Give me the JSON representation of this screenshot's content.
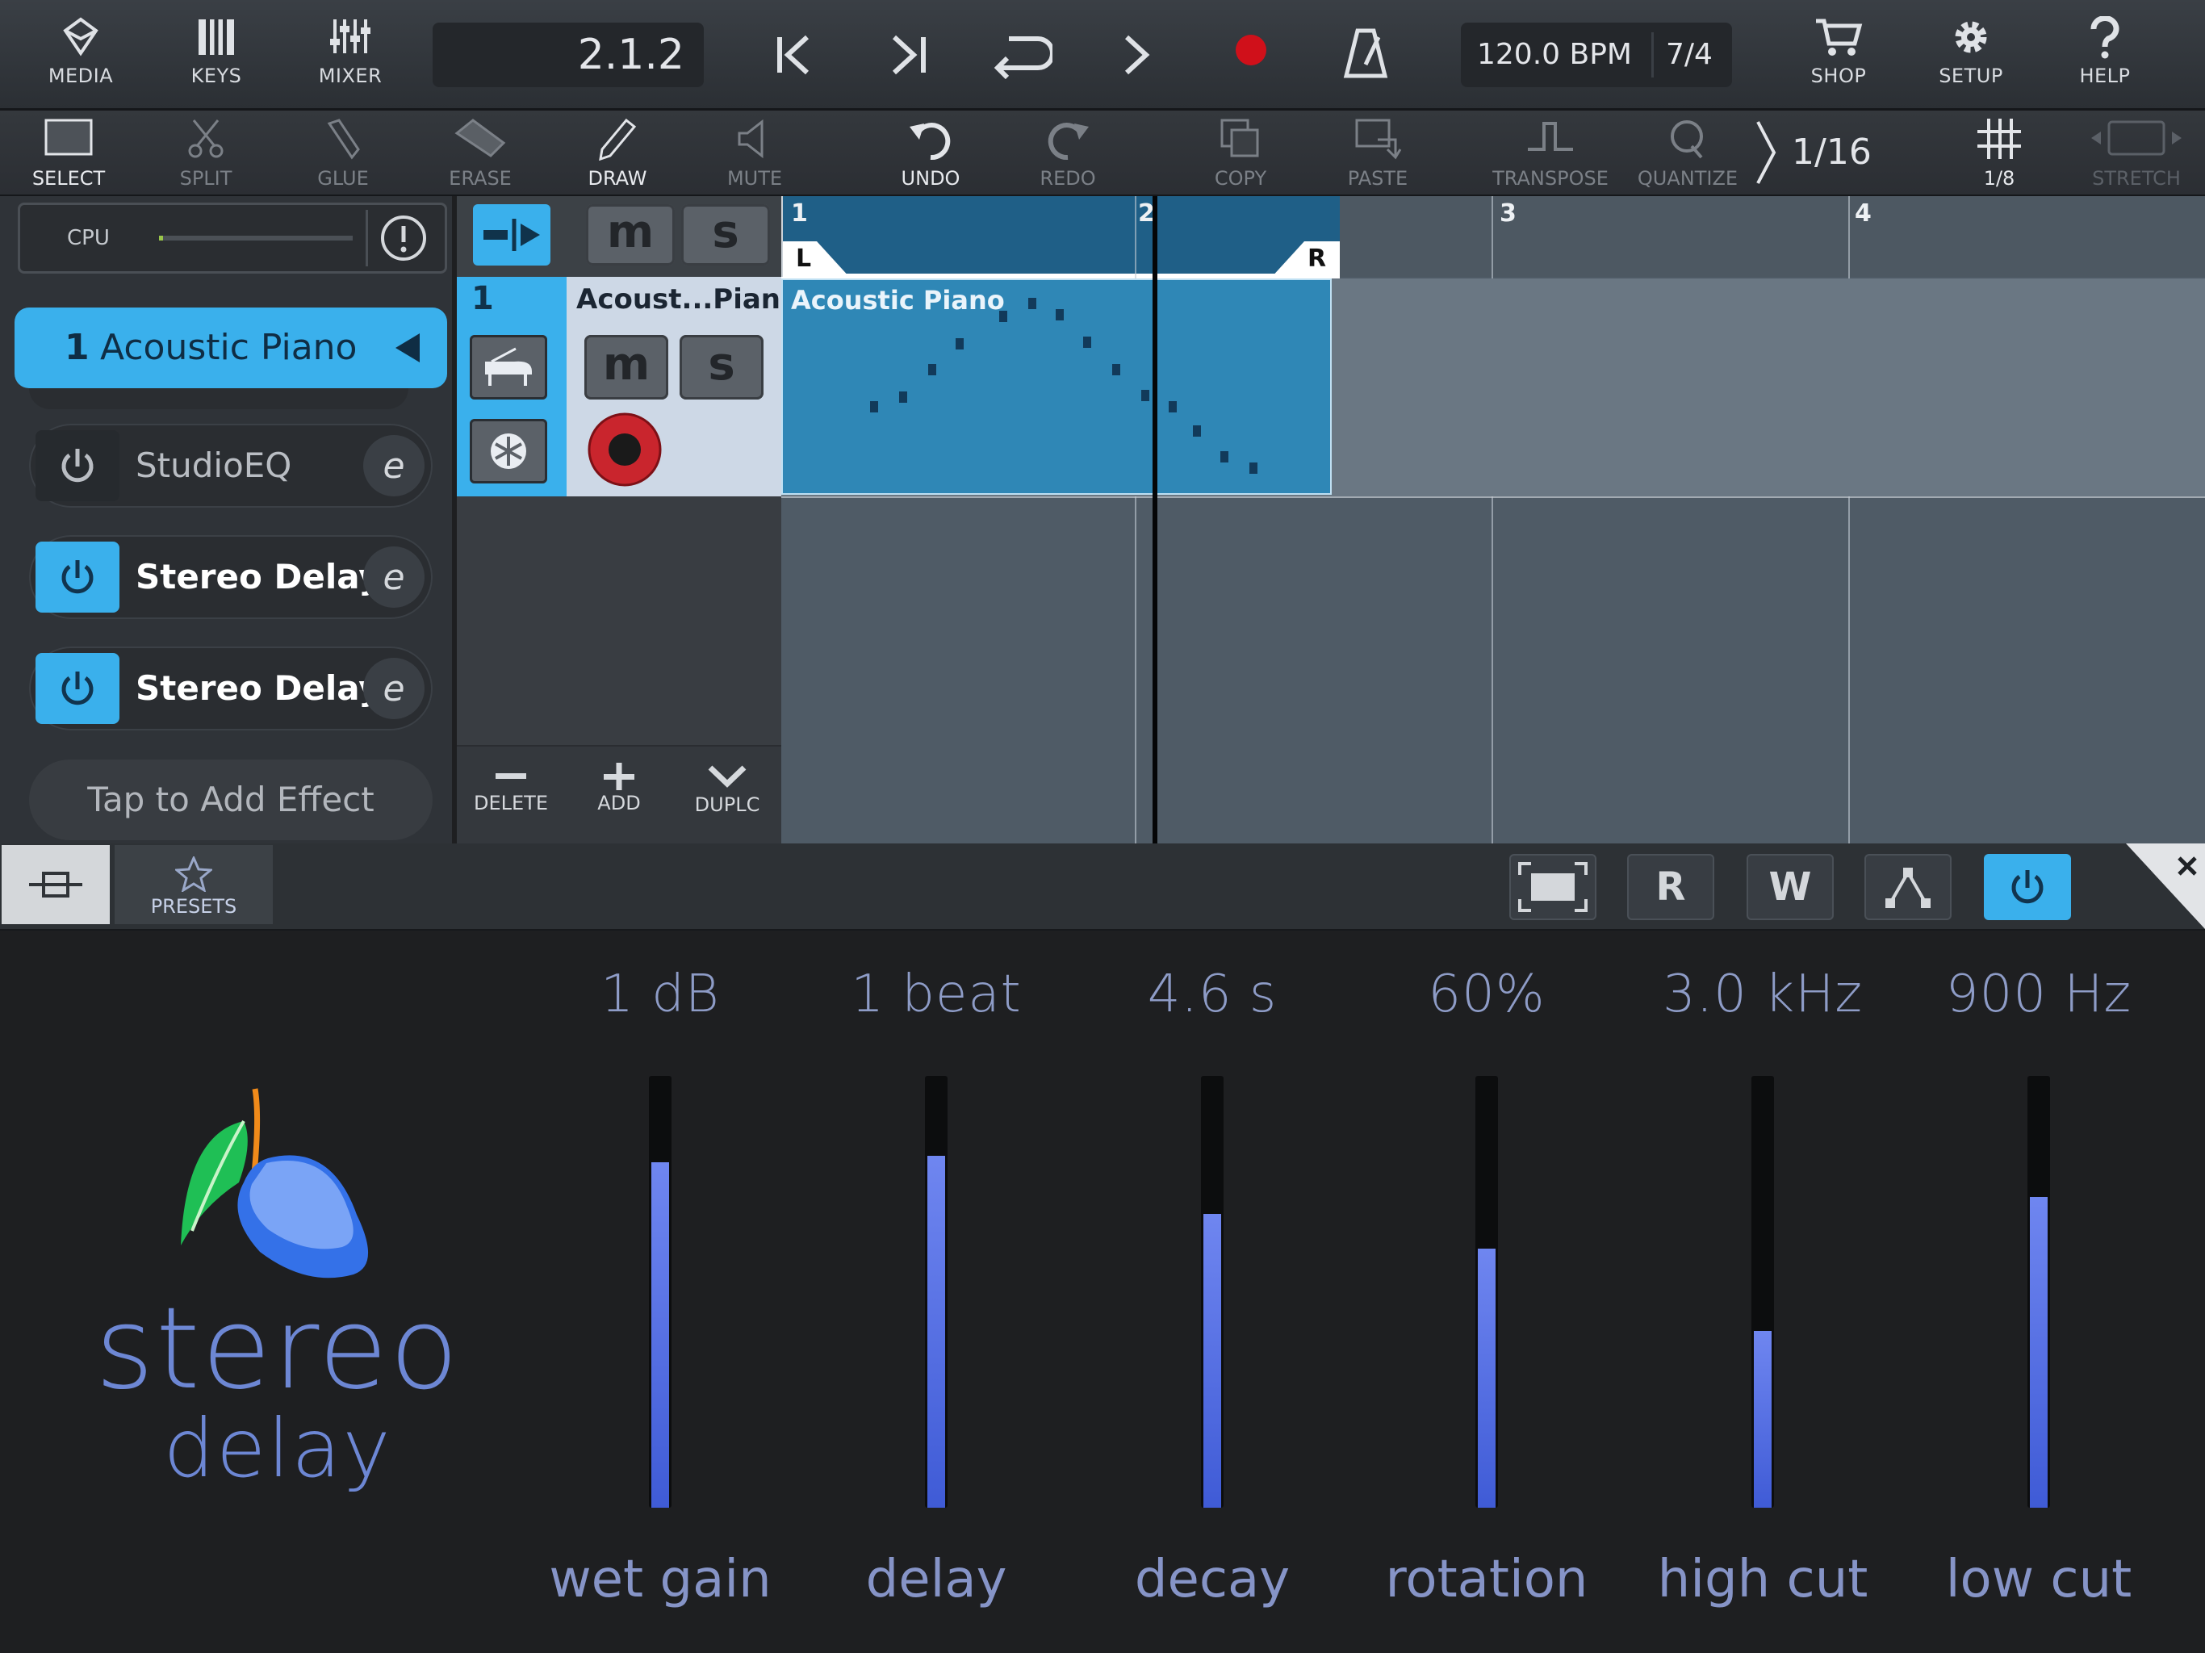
{
  "topbar": {
    "media_label": "MEDIA",
    "keys_label": "KEYS",
    "mixer_label": "MIXER",
    "position": "2.1.2",
    "tempo": "120.0 BPM",
    "time_signature": "7/4",
    "shop_label": "SHOP",
    "setup_label": "SETUP",
    "help_label": "HELP",
    "record_color": "#d0101a"
  },
  "toolbar": {
    "select": "SELECT",
    "split": "SPLIT",
    "glue": "GLUE",
    "erase": "ERASE",
    "draw": "DRAW",
    "mute": "MUTE",
    "undo": "UNDO",
    "redo": "REDO",
    "copy": "COPY",
    "paste": "PASTE",
    "transpose": "TRANSPOSE",
    "quantize": "QUANTIZE",
    "quantize_value": "1/16",
    "grid_value": "1/8",
    "stretch": "STRETCH"
  },
  "left": {
    "cpu_label": "CPU",
    "track_number": "1",
    "track_name": "Acoustic Piano",
    "effects": [
      {
        "name": "StudioEQ",
        "enabled": false
      },
      {
        "name": "Stereo Delay",
        "enabled": true
      },
      {
        "name": "Stereo Delay",
        "enabled": true
      }
    ],
    "add_effect_label": "Tap to Add Effect"
  },
  "track_header": {
    "mute_glyph": "m",
    "solo_glyph": "s",
    "number": "1",
    "short_name": "Acoust...Piano",
    "delete_label": "DELETE",
    "add_label": "ADD",
    "duplicate_label": "DUPLC"
  },
  "arrange": {
    "bars": [
      "1",
      "2",
      "3",
      "4"
    ],
    "loop_left": "L",
    "loop_right": "R",
    "region_name": "Acoustic Piano",
    "accent_color": "#2f87b6"
  },
  "plugin_bar": {
    "presets_label": "PRESETS",
    "read_glyph": "R",
    "write_glyph": "W",
    "accent_color": "#3ab0ec"
  },
  "plugin": {
    "name_line1": "stereo",
    "name_line2": "delay",
    "params": [
      {
        "label": "wet gain",
        "value": "1 dB",
        "level": 0.8
      },
      {
        "label": "delay",
        "value": "1 beat",
        "level": 0.815
      },
      {
        "label": "decay",
        "value": "4.6 s",
        "level": 0.68
      },
      {
        "label": "rotation",
        "value": "60%",
        "level": 0.6
      },
      {
        "label": "high cut",
        "value": "3.0 kHz",
        "level": 0.41
      },
      {
        "label": "low cut",
        "value": "900 Hz",
        "level": 0.72
      }
    ]
  }
}
